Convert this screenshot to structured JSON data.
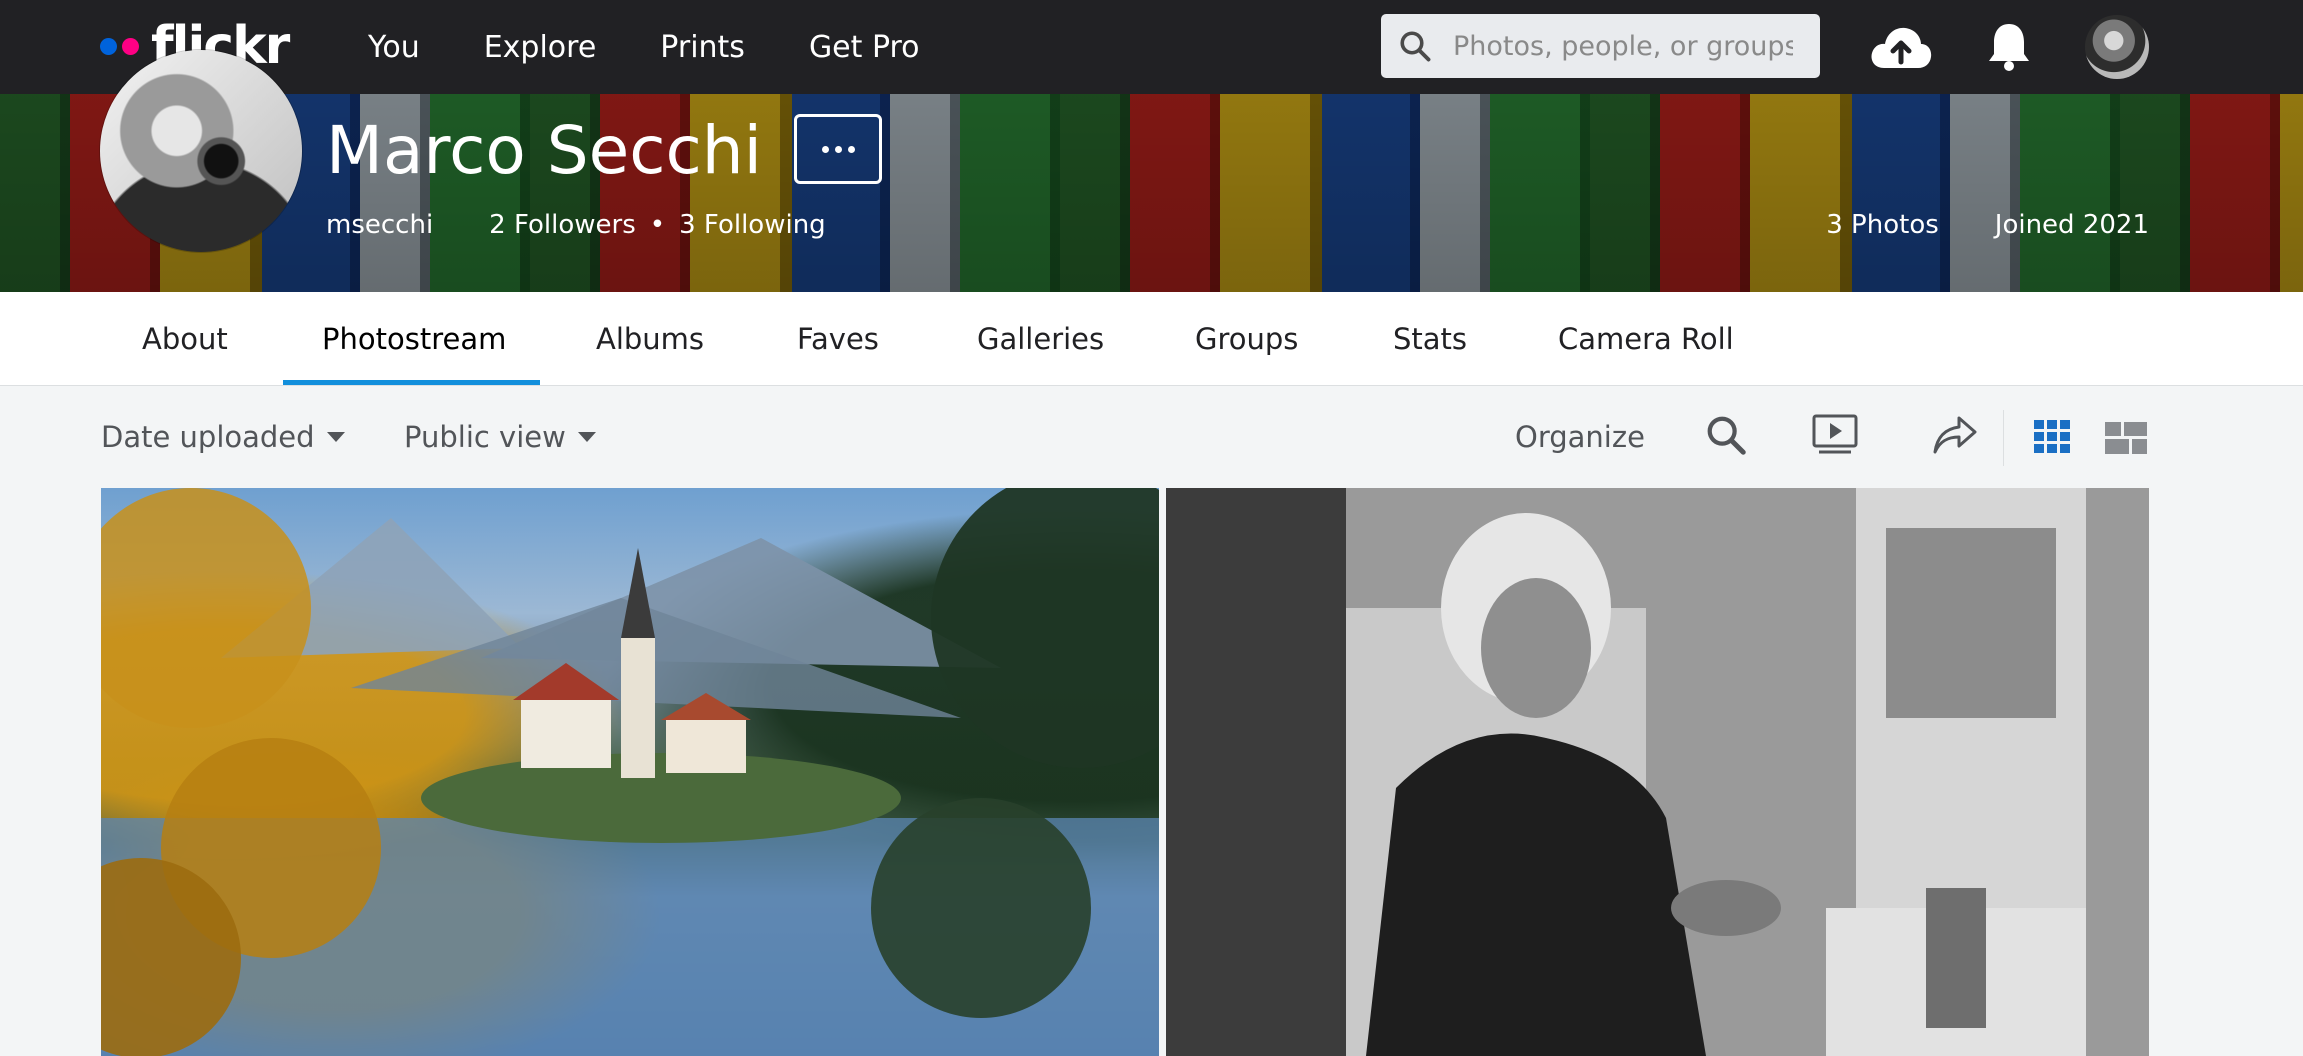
{
  "nav": {
    "logo": "flickr",
    "links": [
      "You",
      "Explore",
      "Prints",
      "Get Pro"
    ],
    "search_placeholder": "Photos, people, or groups",
    "icons": [
      "search-icon",
      "upload-cloud-icon",
      "notification-bell-icon",
      "user-avatar"
    ]
  },
  "profile": {
    "name": "Marco Secchi",
    "username": "msecchi",
    "followers": "2 Followers",
    "following": "3 Following",
    "photos": "3 Photos",
    "joined": "Joined 2021"
  },
  "tabs": [
    {
      "label": "About",
      "active": false
    },
    {
      "label": "Photostream",
      "active": true
    },
    {
      "label": "Albums",
      "active": false
    },
    {
      "label": "Faves",
      "active": false
    },
    {
      "label": "Galleries",
      "active": false
    },
    {
      "label": "Groups",
      "active": false
    },
    {
      "label": "Stats",
      "active": false
    },
    {
      "label": "Camera Roll",
      "active": false
    }
  ],
  "toolbar": {
    "sort": "Date uploaded",
    "view": "Public view",
    "organize": "Organize",
    "icons": [
      "search-icon",
      "slideshow-icon",
      "share-icon",
      "grid-view-icon",
      "justified-view-icon"
    ]
  },
  "colors": {
    "nav_bg": "#212124",
    "accent_blue": "#128fdc",
    "logo_blue": "#0063dc",
    "logo_pink": "#ff0084",
    "page_bg": "#f3f5f6"
  }
}
